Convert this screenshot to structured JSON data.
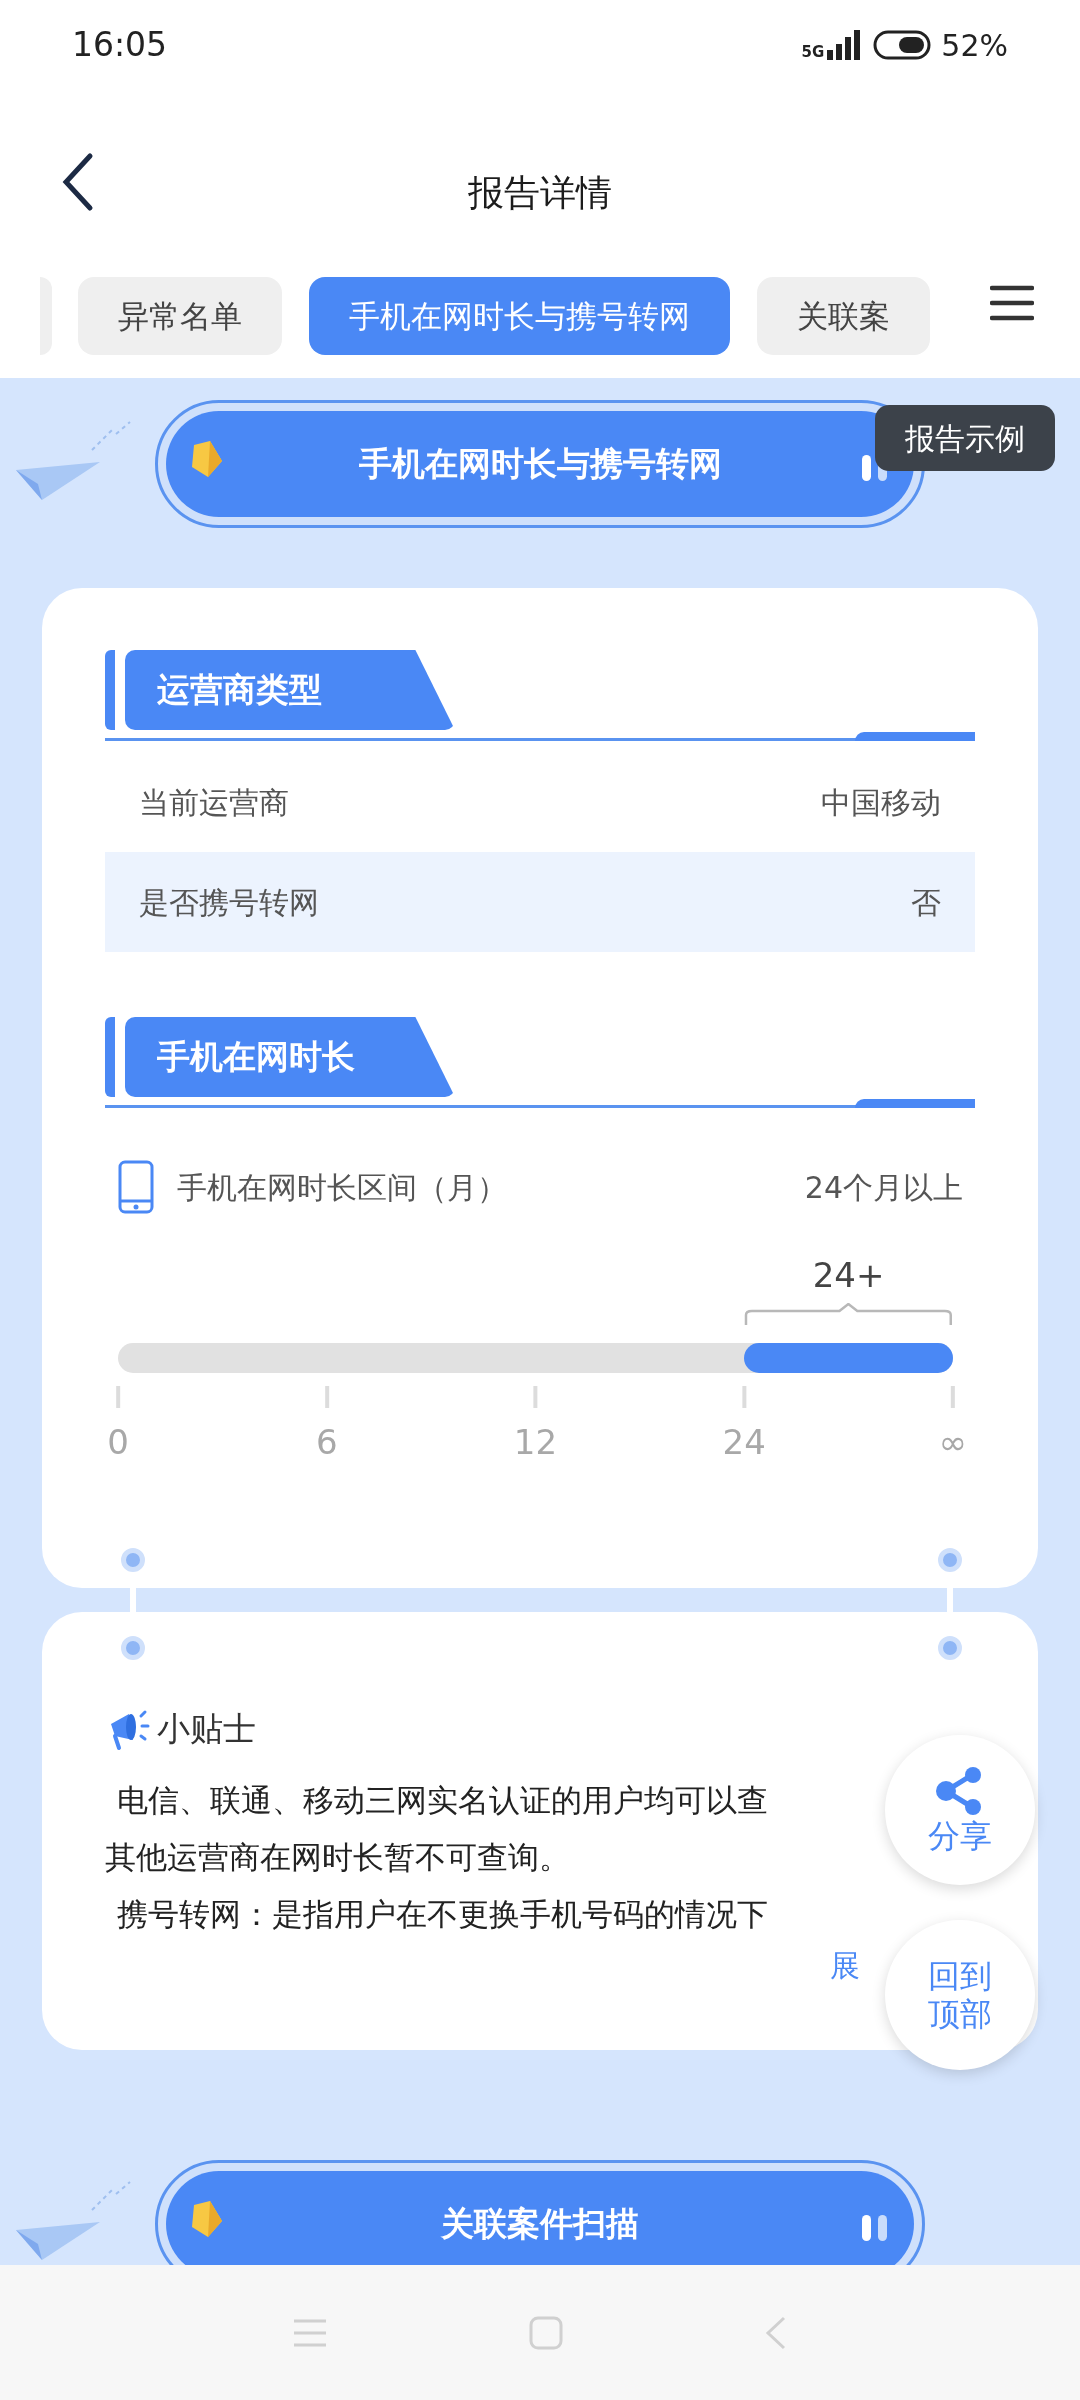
{
  "status_bar": {
    "time": "16:05",
    "network": "5G",
    "battery": "52%"
  },
  "header": {
    "title": "报告详情"
  },
  "tabs": [
    {
      "label": "异常名单",
      "selected": false
    },
    {
      "label": "手机在网时长与携号转网",
      "selected": true
    },
    {
      "label": "关联案",
      "selected": false
    }
  ],
  "section_banner": {
    "title": "手机在网时长与携号转网"
  },
  "report_example_badge": "报告示例",
  "operator_section": {
    "heading": "运营商类型",
    "rows": [
      {
        "label": "当前运营商",
        "value": "中国移动",
        "highlighted": false
      },
      {
        "label": "是否携号转网",
        "value": "否",
        "highlighted": true
      }
    ]
  },
  "tenure_section": {
    "heading": "手机在网时长",
    "label": "手机在网时长区间（月）",
    "value": "24个月以上",
    "scale": {
      "ticks": [
        "0",
        "6",
        "12",
        "24",
        "∞"
      ],
      "segments": [
        {
          "selected": false
        },
        {
          "selected": false
        },
        {
          "selected": false
        },
        {
          "selected": true,
          "label": "24+"
        }
      ]
    }
  },
  "tips": {
    "title": "小贴士",
    "lines": [
      "电信、联通、移动三网实名认证的用户均可以查",
      "其他运营商在网时长暂不可查询。",
      "携号转网：是指用户在不更换手机号码的情况下"
    ],
    "expand": "展"
  },
  "floating_buttons": [
    {
      "kind": "share",
      "label": "分享"
    },
    {
      "kind": "top",
      "label": "回到顶部"
    }
  ],
  "next_banner": {
    "title": "关联案件扫描"
  }
}
